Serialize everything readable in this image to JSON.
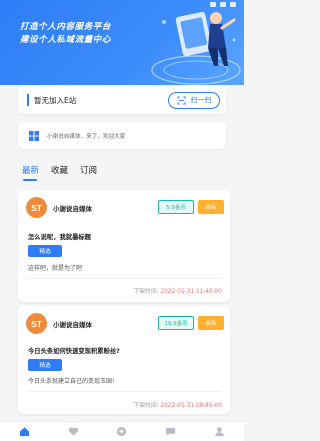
{
  "hero": {
    "title_line1": "打造个人内容服务平台",
    "title_line2": "建设个人私域流量中心",
    "bg_color": "#2f7df6"
  },
  "join": {
    "text": "暂无加入E站",
    "scan_label": "扫一扫",
    "scan_icon": "scan-icon"
  },
  "notice": {
    "icon": "windows-icon",
    "text": "小谢说自媒体，来了。欢迎大家"
  },
  "tabs": [
    {
      "label": "最新",
      "active": true
    },
    {
      "label": "收藏",
      "active": false
    },
    {
      "label": "订阅",
      "active": false
    }
  ],
  "posts": [
    {
      "avatar": "ST",
      "author": "小谢说自媒体",
      "price": "5.9金币",
      "status": "自有",
      "question": "怎么说呢，我就暴标题",
      "tag": "精选",
      "description": "这样吧，就是为了吧",
      "time_label": "下架时间:",
      "time_value": "2022-01-31 11:45:00"
    },
    {
      "avatar": "ST",
      "author": "小谢说自媒体",
      "price": "19.9金币",
      "status": "自有",
      "question": "今日头条如何快速变现积累粉丝?",
      "tag": "精选",
      "description": "今日头条就建立自己的变现玉国!",
      "time_label": "下架时间:",
      "time_value": "2022-01-31 09:45:00"
    }
  ],
  "bottom_nav": [
    {
      "icon": "home-icon",
      "active": true
    },
    {
      "icon": "heart-icon",
      "active": false
    },
    {
      "icon": "add-icon",
      "active": false
    },
    {
      "icon": "message-icon",
      "active": false
    },
    {
      "icon": "profile-icon",
      "active": false
    }
  ],
  "colors": {
    "accent": "#2f7df6",
    "teal": "#19b9a7",
    "orange": "#ffb02e",
    "avatar": "#f08a3c",
    "time_red": "#f36d6d"
  }
}
